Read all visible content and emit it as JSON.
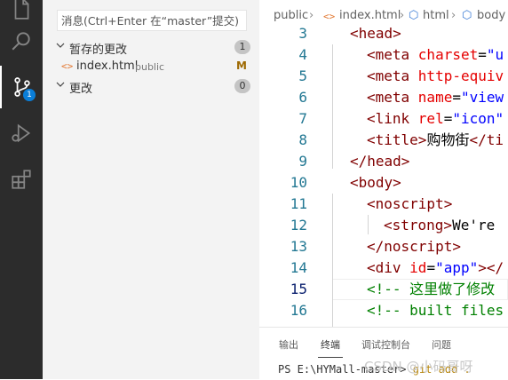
{
  "activity_bar": {
    "items": [
      {
        "name": "explorer"
      },
      {
        "name": "search"
      },
      {
        "name": "source-control",
        "badge": "1"
      },
      {
        "name": "run-and-debug"
      },
      {
        "name": "extensions"
      }
    ]
  },
  "scm": {
    "commit_placeholder": "消息(Ctrl+Enter 在“master”提交)",
    "staged": {
      "label": "暂存的更改",
      "count": "1"
    },
    "files": [
      {
        "name": "index.html",
        "path": "public",
        "status": "M"
      }
    ],
    "changes": {
      "label": "更改",
      "count": "0"
    }
  },
  "breadcrumb": {
    "folder": "public",
    "file": "index.html",
    "node1": "html",
    "node2": "body"
  },
  "editor": {
    "current_line": 15,
    "lines": [
      {
        "num": "3",
        "tokens": [
          {
            "t": "tag",
            "v": "<head>"
          }
        ]
      },
      {
        "num": "4",
        "tokens": [
          {
            "t": "tag",
            "v": "<meta "
          },
          {
            "t": "attr",
            "v": "charset"
          },
          {
            "t": "txt",
            "v": "="
          },
          {
            "t": "str",
            "v": "\"u"
          }
        ]
      },
      {
        "num": "5",
        "tokens": [
          {
            "t": "tag",
            "v": "<meta "
          },
          {
            "t": "attr",
            "v": "http-equiv"
          }
        ]
      },
      {
        "num": "6",
        "tokens": [
          {
            "t": "tag",
            "v": "<meta "
          },
          {
            "t": "attr",
            "v": "name"
          },
          {
            "t": "txt",
            "v": "="
          },
          {
            "t": "str",
            "v": "\"view"
          }
        ]
      },
      {
        "num": "7",
        "tokens": [
          {
            "t": "tag",
            "v": "<link "
          },
          {
            "t": "attr",
            "v": "rel"
          },
          {
            "t": "txt",
            "v": "="
          },
          {
            "t": "str",
            "v": "\"icon\""
          }
        ]
      },
      {
        "num": "8",
        "tokens": [
          {
            "t": "tag",
            "v": "<title>"
          },
          {
            "t": "txt",
            "v": "购物街"
          },
          {
            "t": "tag",
            "v": "</ti"
          }
        ]
      },
      {
        "num": "9",
        "tokens": [
          {
            "t": "tag",
            "v": "</head>"
          }
        ]
      },
      {
        "num": "10",
        "tokens": [
          {
            "t": "tag",
            "v": "<body>"
          }
        ]
      },
      {
        "num": "11",
        "tokens": [
          {
            "t": "tag",
            "v": "<noscript>"
          }
        ]
      },
      {
        "num": "12",
        "tokens": [
          {
            "t": "tag",
            "v": "<strong>"
          },
          {
            "t": "txt",
            "v": "We're"
          }
        ]
      },
      {
        "num": "13",
        "tokens": [
          {
            "t": "tag",
            "v": "</noscript>"
          }
        ]
      },
      {
        "num": "14",
        "tokens": [
          {
            "t": "tag",
            "v": "<div "
          },
          {
            "t": "attr",
            "v": "id"
          },
          {
            "t": "txt",
            "v": "="
          },
          {
            "t": "str",
            "v": "\"app\""
          },
          {
            "t": "tag",
            "v": "></"
          }
        ]
      },
      {
        "num": "15",
        "tokens": [
          {
            "t": "cmt",
            "v": "<!-- 这里做了修改"
          }
        ]
      },
      {
        "num": "16",
        "tokens": [
          {
            "t": "cmt",
            "v": "<!-- built files"
          }
        ]
      }
    ]
  },
  "panel": {
    "tabs": [
      "输出",
      "终端",
      "调试控制台",
      "问题"
    ],
    "active_tab": "终端",
    "terminal_prompt": "PS E:\\HYMall-master> ",
    "terminal_cmd": "git add ."
  },
  "watermark": "CSDN @小码哥呀",
  "colors": {
    "activity_bg": "#2c2c2c",
    "sidebar_bg": "#f3f3f3",
    "badge": "#0a7ed8",
    "tag": "#800000",
    "attr": "#e50000",
    "string": "#0000ff",
    "comment": "#008000"
  }
}
